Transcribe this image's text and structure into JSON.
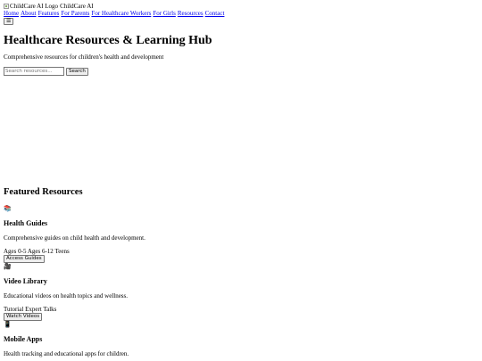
{
  "header": {
    "logo_alt": "ChildCare AI Logo",
    "brand_name": "ChildCare AI",
    "nav": [
      {
        "label": "Home"
      },
      {
        "label": "About"
      },
      {
        "label": "Features"
      },
      {
        "label": "For Parents"
      },
      {
        "label": "For Healthcare Workers"
      },
      {
        "label": "For Girls"
      },
      {
        "label": "Resources"
      },
      {
        "label": "Contact"
      }
    ],
    "menu_toggle_icon": "hamburger-icon",
    "menu_toggle_glyph": "☰"
  },
  "hero": {
    "title": "Healthcare Resources & Learning Hub",
    "subtitle": "Comprehensive resources for children's health and development",
    "search": {
      "placeholder": "Search resources...",
      "value": "",
      "button_label": "Search"
    }
  },
  "featured": {
    "heading": "Featured Resources",
    "cards": [
      {
        "icon": "books-icon",
        "glyph": "📚",
        "title": "Health Guides",
        "description": "Comprehensive guides on child health and development.",
        "tags": [
          "Ages 0-5",
          "Ages 6-12",
          "Teens"
        ],
        "button_label": "Access Guides"
      },
      {
        "icon": "video-camera-icon",
        "glyph": "🎥",
        "title": "Video Library",
        "description": "Educational videos on health topics and wellness.",
        "tags": [
          "Tutorial",
          "Expert Talks"
        ],
        "button_label": "Watch Videos"
      },
      {
        "icon": "mobile-phone-icon",
        "glyph": "📱",
        "title": "Mobile Apps",
        "description": "Health tracking and educational apps for children.",
        "tags": [],
        "button_label": ""
      }
    ]
  }
}
